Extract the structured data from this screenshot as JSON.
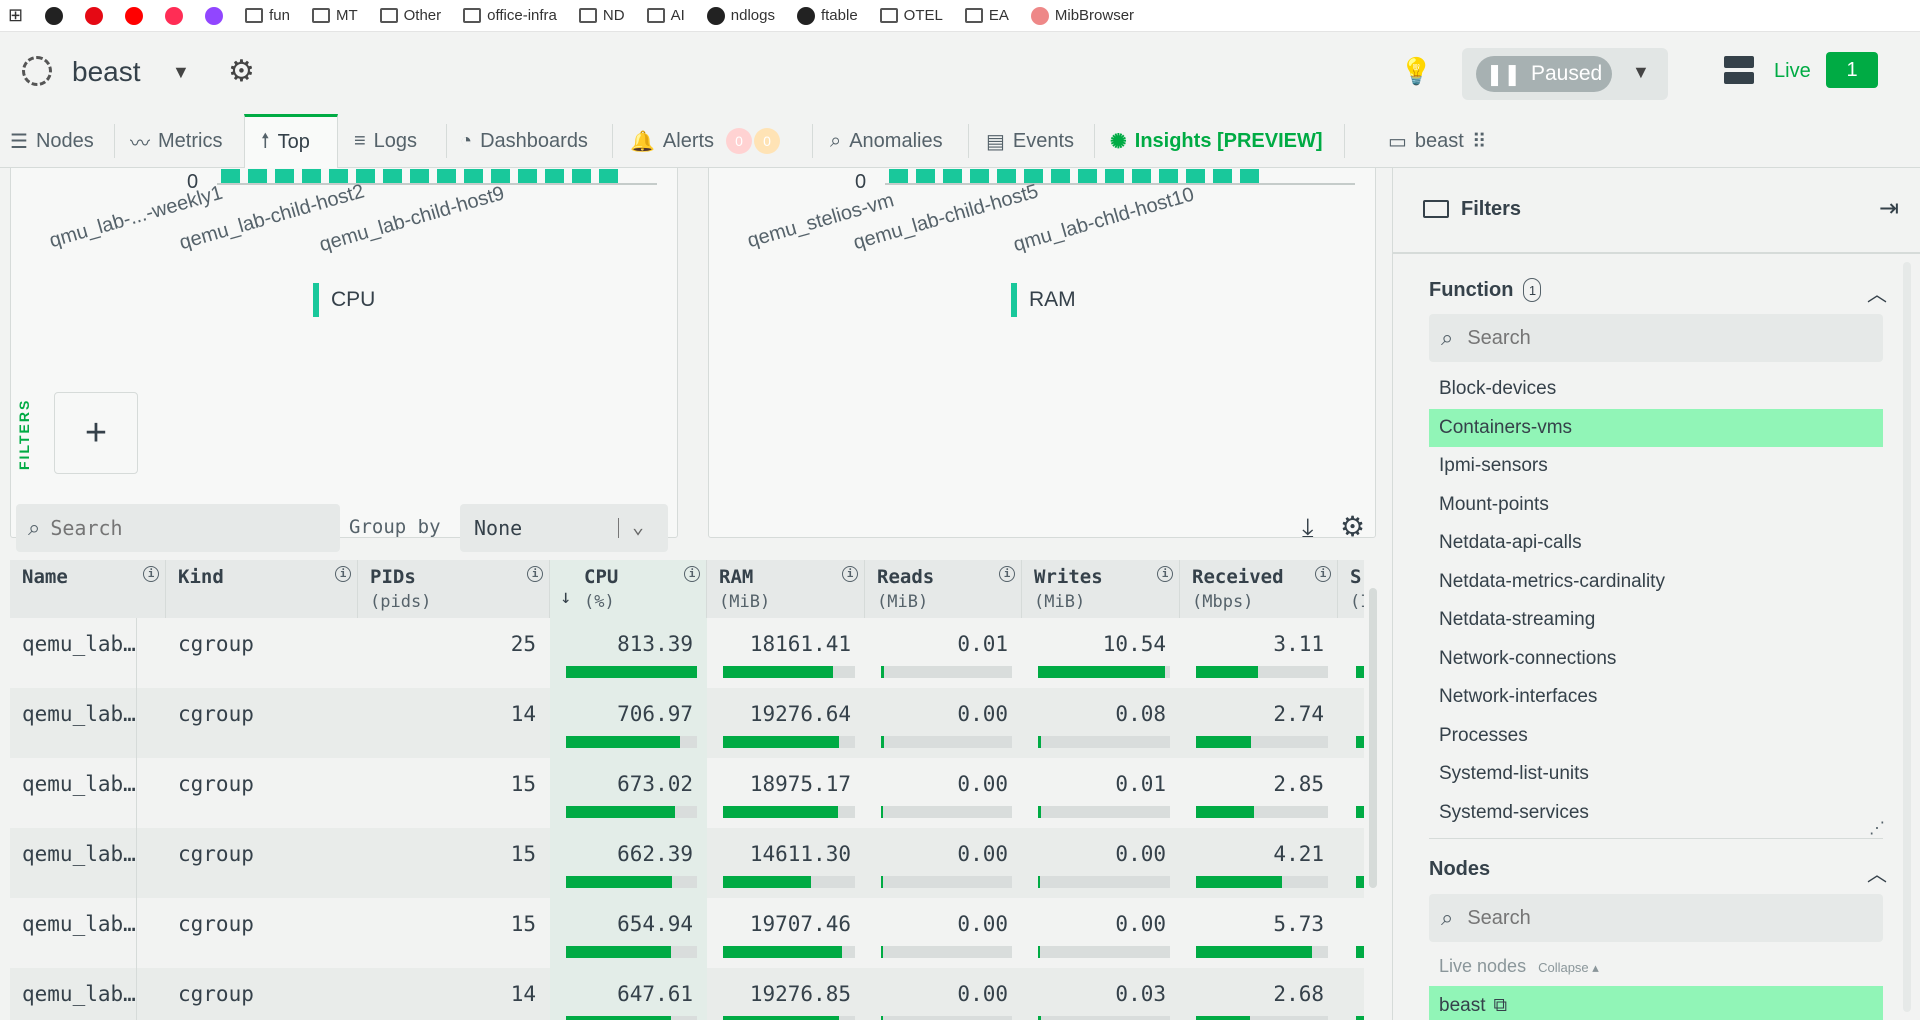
{
  "bookmarks": [
    {
      "label": "",
      "icon": "apps-grid-icon"
    },
    {
      "label": "",
      "icon": "github-icon"
    },
    {
      "label": "",
      "icon": "netflix-icon"
    },
    {
      "label": "",
      "icon": "youtube-icon"
    },
    {
      "label": "",
      "icon": "music-icon"
    },
    {
      "label": "",
      "icon": "twitch-icon"
    },
    {
      "label": "fun",
      "icon": "folder-icon"
    },
    {
      "label": "MT",
      "icon": "folder-icon"
    },
    {
      "label": "Other",
      "icon": "folder-icon"
    },
    {
      "label": "office-infra",
      "icon": "folder-icon"
    },
    {
      "label": "ND",
      "icon": "folder-icon"
    },
    {
      "label": "AI",
      "icon": "folder-icon"
    },
    {
      "label": "ndlogs",
      "icon": "github-icon"
    },
    {
      "label": "ftable",
      "icon": "github-icon"
    },
    {
      "label": "OTEL",
      "icon": "folder-icon"
    },
    {
      "label": "EA",
      "icon": "folder-icon"
    },
    {
      "label": "MibBrowser",
      "icon": "mib-icon"
    }
  ],
  "header": {
    "space_name": "beast",
    "paused_label": "Paused",
    "live_label": "Live",
    "live_count": "1"
  },
  "tabs": [
    {
      "label": "Nodes",
      "icon": "nodes-icon"
    },
    {
      "label": "Metrics",
      "icon": "metrics-icon"
    },
    {
      "label": "Top",
      "icon": "top-arrow-icon"
    },
    {
      "label": "Logs",
      "icon": "logs-icon"
    },
    {
      "label": "Dashboards",
      "icon": "dashboards-icon"
    },
    {
      "label": "Alerts",
      "icon": "bell-icon",
      "critical": "0",
      "warning": "0"
    },
    {
      "label": "Anomalies",
      "icon": "anomalies-icon"
    },
    {
      "label": "Events",
      "icon": "events-icon"
    },
    {
      "label": "Insights [PREVIEW]",
      "icon": "lightbulb-icon"
    },
    {
      "label": "beast",
      "icon": "room-icon"
    }
  ],
  "charts": [
    {
      "zero_tick": "0",
      "x_labels": [
        "qmu_lab-...-weekly1",
        "qemu_lab-child-host2",
        "qemu_lab-child-host9"
      ],
      "legend": "CPU",
      "legend_color": "#19c89b"
    },
    {
      "zero_tick": "0",
      "x_labels": [
        "qemu_stelios-vm",
        "qemu_lab-child-host5",
        "qmu_lab-chld-host10"
      ],
      "legend": "RAM",
      "legend_color": "#19c89b"
    }
  ],
  "filters_vertical_label": "FILTERS",
  "add_filter_symbol": "+",
  "toolbar": {
    "search_placeholder": "Search",
    "group_by_label": "Group by",
    "group_by_value": "None"
  },
  "table": {
    "columns": [
      {
        "name": "Name",
        "unit": ""
      },
      {
        "name": "Kind",
        "unit": ""
      },
      {
        "name": "PIDs",
        "unit": "(pids)"
      },
      {
        "name": "CPU",
        "unit": "(%)"
      },
      {
        "name": "RAM",
        "unit": "(MiB)"
      },
      {
        "name": "Reads",
        "unit": "(MiB)"
      },
      {
        "name": "Writes",
        "unit": "(MiB)"
      },
      {
        "name": "Received",
        "unit": "(Mbps)"
      },
      {
        "name": "S",
        "unit": "(I"
      }
    ],
    "sort_indicator": "↓",
    "rows": [
      {
        "name": "qemu_lab…",
        "kind": "cgroup",
        "pids": "25",
        "cpu": "813.39",
        "ram": "18161.41",
        "reads": "0.01",
        "writes": "10.54",
        "received": "3.11",
        "cpu_frac": 1.0,
        "ram_frac": 0.83,
        "reads_frac": 0.02,
        "writes_frac": 0.96,
        "received_frac": 0.47
      },
      {
        "name": "qemu_lab…",
        "kind": "cgroup",
        "pids": "14",
        "cpu": "706.97",
        "ram": "19276.64",
        "reads": "0.00",
        "writes": "0.08",
        "received": "2.74",
        "cpu_frac": 0.87,
        "ram_frac": 0.88,
        "reads_frac": 0.01,
        "writes_frac": 0.02,
        "received_frac": 0.42
      },
      {
        "name": "qemu_lab…",
        "kind": "cgroup",
        "pids": "15",
        "cpu": "673.02",
        "ram": "18975.17",
        "reads": "0.00",
        "writes": "0.01",
        "received": "2.85",
        "cpu_frac": 0.83,
        "ram_frac": 0.87,
        "reads_frac": 0.0,
        "writes_frac": 0.01,
        "received_frac": 0.44
      },
      {
        "name": "qemu_lab…",
        "kind": "cgroup",
        "pids": "15",
        "cpu": "662.39",
        "ram": "14611.30",
        "reads": "0.00",
        "writes": "0.00",
        "received": "4.21",
        "cpu_frac": 0.81,
        "ram_frac": 0.67,
        "reads_frac": 0.0,
        "writes_frac": 0.0,
        "received_frac": 0.65
      },
      {
        "name": "qemu_lab…",
        "kind": "cgroup",
        "pids": "15",
        "cpu": "654.94",
        "ram": "19707.46",
        "reads": "0.00",
        "writes": "0.00",
        "received": "5.73",
        "cpu_frac": 0.8,
        "ram_frac": 0.9,
        "reads_frac": 0.0,
        "writes_frac": 0.0,
        "received_frac": 0.88
      },
      {
        "name": "qemu_lab…",
        "kind": "cgroup",
        "pids": "14",
        "cpu": "647.61",
        "ram": "19276.85",
        "reads": "0.00",
        "writes": "0.03",
        "received": "2.68",
        "cpu_frac": 0.8,
        "ram_frac": 0.88,
        "reads_frac": 0.0,
        "writes_frac": 0.01,
        "received_frac": 0.41
      }
    ]
  },
  "panel": {
    "title": "Filters",
    "function": {
      "title": "Function",
      "count": "1",
      "search_placeholder": "Search",
      "items": [
        "Block-devices",
        "Containers-vms",
        "Ipmi-sensors",
        "Mount-points",
        "Netdata-api-calls",
        "Netdata-metrics-cardinality",
        "Netdata-streaming",
        "Network-connections",
        "Network-interfaces",
        "Processes",
        "Systemd-list-units",
        "Systemd-services"
      ],
      "selected": "Containers-vms"
    },
    "nodes": {
      "title": "Nodes",
      "search_placeholder": "Search",
      "live_nodes_label": "Live nodes",
      "collapse_label": "Collapse",
      "node": "beast"
    }
  }
}
